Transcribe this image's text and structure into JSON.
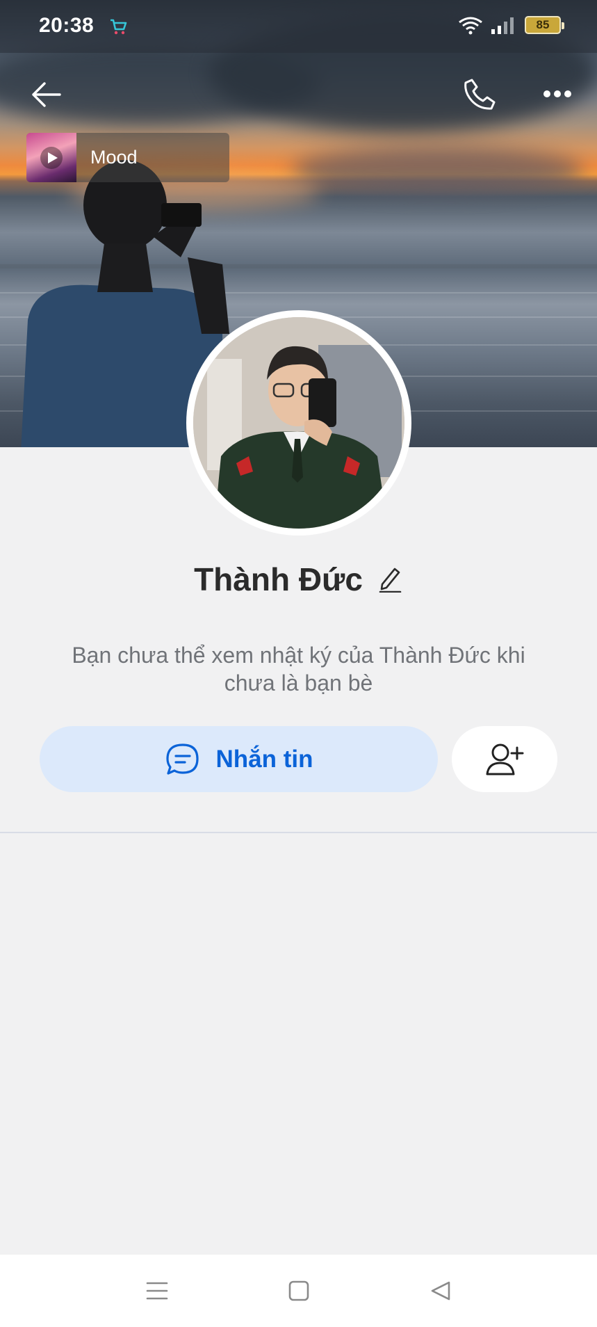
{
  "status_bar": {
    "time": "20:38",
    "battery_level": "85",
    "icons": [
      "shopping-cart-icon",
      "wifi-icon",
      "signal-icon",
      "battery-icon"
    ]
  },
  "nav": {
    "back_icon": "arrow-left-icon",
    "call_icon": "phone-icon",
    "more_icon": "more-horizontal-icon"
  },
  "mood": {
    "label": "Mood",
    "icon": "play-icon"
  },
  "profile": {
    "name": "Thành Đức",
    "edit_icon": "pencil-icon",
    "notice_line1": "Bạn chưa thể xem nhật ký của Thành Đức khi",
    "notice_line2": "chưa là bạn bè"
  },
  "actions": {
    "message_label": "Nhắn tin",
    "message_icon": "chat-bubble-icon",
    "add_friend_icon": "add-user-icon"
  },
  "system_nav": {
    "icons": [
      "menu-icon",
      "home-icon",
      "back-triangle-icon"
    ]
  },
  "colors": {
    "accent": "#0b63d8",
    "message_button_bg": "#dce9fb",
    "page_bg": "#f1f1f2"
  }
}
